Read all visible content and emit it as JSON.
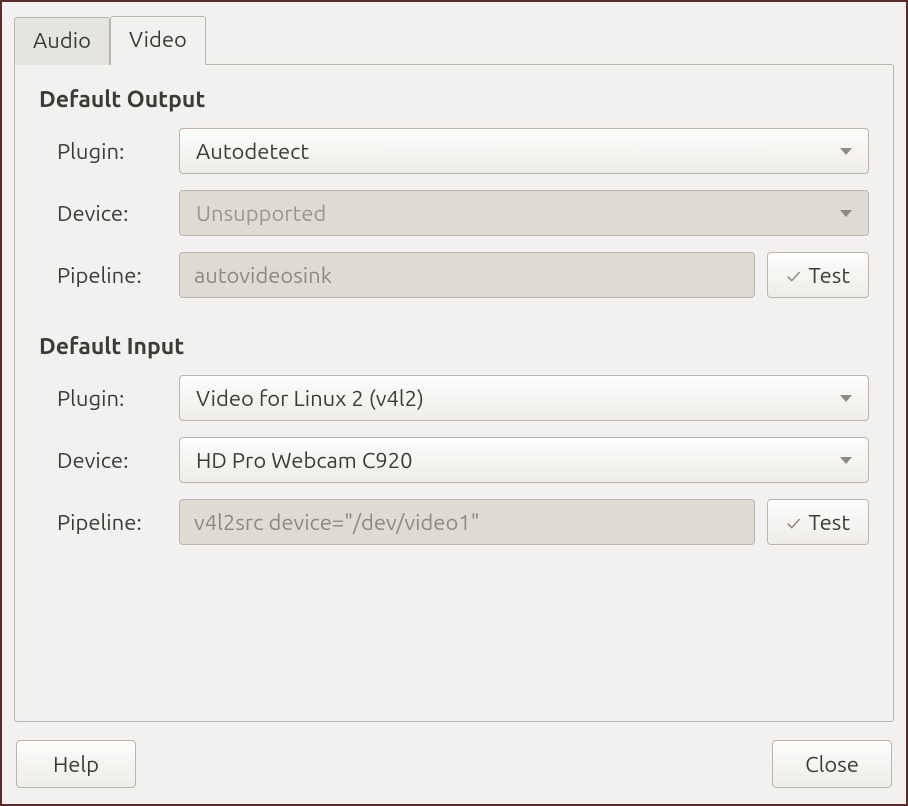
{
  "tabs": {
    "audio": "Audio",
    "video": "Video"
  },
  "output": {
    "title": "Default Output",
    "plugin_label": "Plugin:",
    "plugin_value": "Autodetect",
    "device_label": "Device:",
    "device_value": "Unsupported",
    "pipeline_label": "Pipeline:",
    "pipeline_value": "autovideosink",
    "test_label": "Test"
  },
  "input": {
    "title": "Default Input",
    "plugin_label": "Plugin:",
    "plugin_value": "Video for Linux 2 (v4l2)",
    "device_label": "Device:",
    "device_value": "HD Pro Webcam C920",
    "pipeline_label": "Pipeline:",
    "pipeline_value": "v4l2src device=\"/dev/video1\"",
    "test_label": "Test"
  },
  "footer": {
    "help": "Help",
    "close": "Close"
  }
}
